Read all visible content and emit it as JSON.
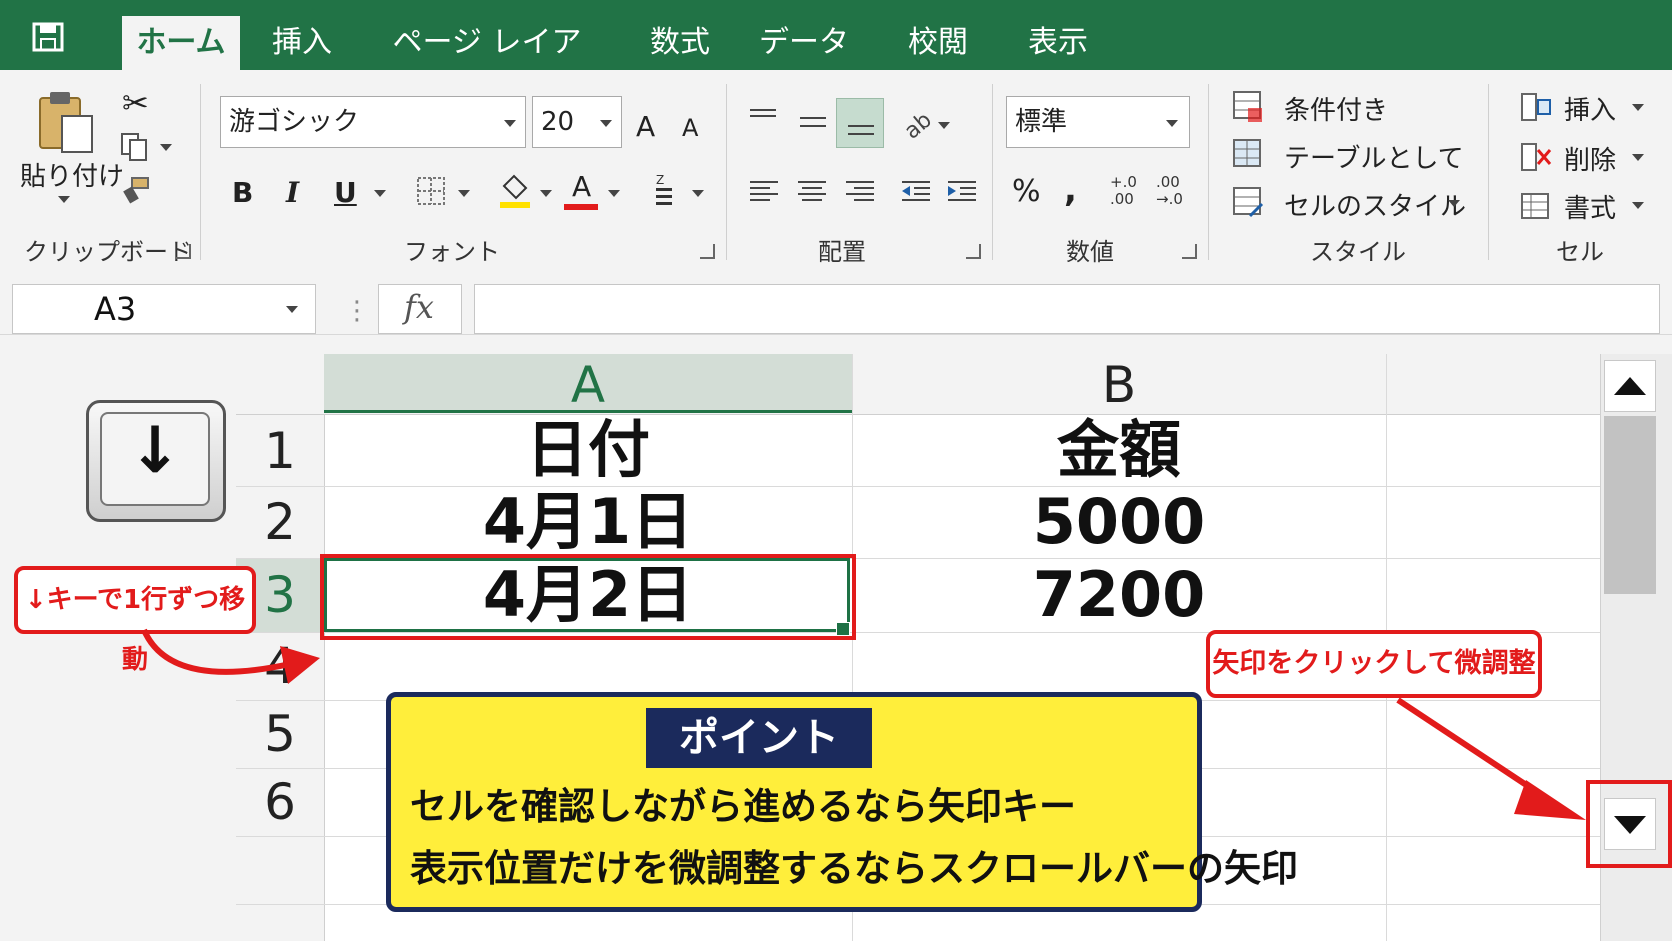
{
  "tabs": [
    "ホーム",
    "挿入",
    "ページ レイアウト",
    "数式",
    "データ",
    "校閲",
    "表示"
  ],
  "active_tab": "ホーム",
  "ribbon": {
    "clipboard": {
      "paste_label": "貼り付け",
      "group_label": "クリップボード"
    },
    "font": {
      "font_name": "游ゴシック",
      "font_size": "20",
      "group_label": "フォント",
      "bold": "B",
      "italic": "I",
      "underline": "U",
      "font_color_letter": "A",
      "grow": "A",
      "shrink": "A"
    },
    "alignment": {
      "group_label": "配置"
    },
    "number": {
      "format": "標準",
      "percent": "%",
      "comma": ",",
      "inc_decimal": "+.0\n.00",
      "dec_decimal": ".00\n→.0",
      "group_label": "数値"
    },
    "styles": {
      "conditional": "条件付き",
      "table": "テーブルとして",
      "cell_style": "セルのスタイル",
      "group_label": "スタイル"
    },
    "cells": {
      "insert": "挿入",
      "delete": "削除",
      "format": "書式",
      "group_label": "セル"
    }
  },
  "formula_bar": {
    "name_box": "A3",
    "fx": "fx",
    "value": ""
  },
  "sheet": {
    "columns": [
      "A",
      "B"
    ],
    "rows": [
      "1",
      "2",
      "3",
      "4",
      "5",
      "6"
    ],
    "selected_cell": "A3",
    "cells": {
      "A1": "日付",
      "B1": "金額",
      "A2": "4月1日",
      "B2": "5000",
      "A3": "4月2日",
      "B3": "7200"
    }
  },
  "keycap": "↓",
  "annotations": {
    "key_callout": "↓キーで1行ずつ移動",
    "arrow_callout": "矢印をクリックして微調整",
    "point_title": "ポイント",
    "point_line1": "セルを確認しながら進めるなら矢印キー",
    "point_line2": "表示位置だけを微調整するならスクロールバーの矢印"
  },
  "colors": {
    "excel_green": "#217346",
    "callout_red": "#e21b1b",
    "point_yellow": "#ffee3b",
    "point_navy": "#1b2a5c"
  }
}
